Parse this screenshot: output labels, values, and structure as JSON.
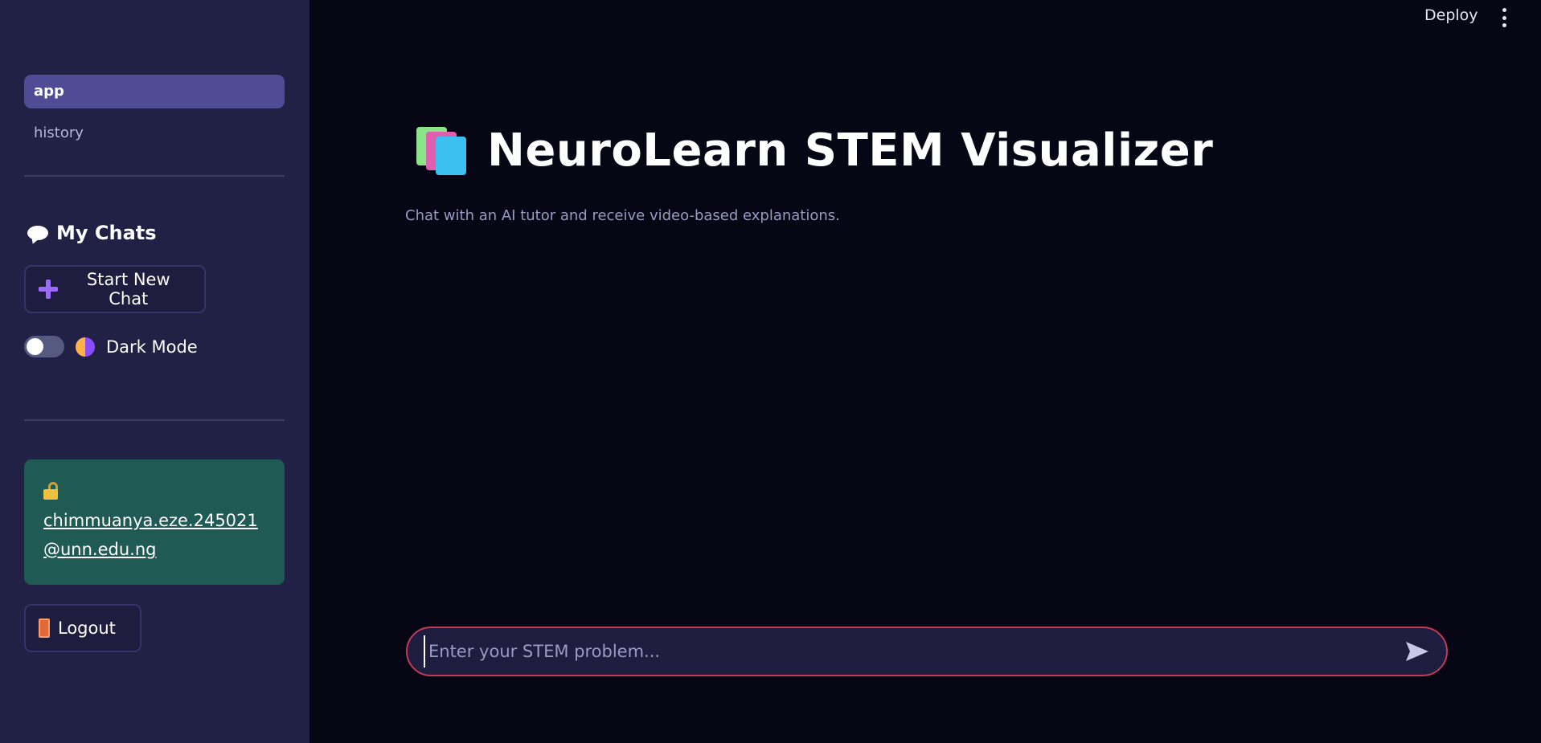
{
  "sidebar": {
    "nav": [
      {
        "label": "app",
        "active": true
      },
      {
        "label": "history",
        "active": false
      }
    ],
    "section_title": "My Chats",
    "new_chat_label": "Start New Chat",
    "dark_mode_label": "Dark Mode",
    "dark_mode_on": false,
    "user_email": "chimmuanya.eze.245021@unn.edu.ng",
    "logout_label": "Logout"
  },
  "header": {
    "deploy_label": "Deploy"
  },
  "main": {
    "title": "NeuroLearn STEM Visualizer",
    "subtitle": "Chat with an AI tutor and receive video-based explanations.",
    "input_placeholder": "Enter your STEM problem..."
  },
  "colors": {
    "sidebar_bg": "#212045",
    "main_bg": "#060615",
    "active_nav": "#4f4c95",
    "user_card": "#1f5a55",
    "input_border": "#c23a55"
  }
}
